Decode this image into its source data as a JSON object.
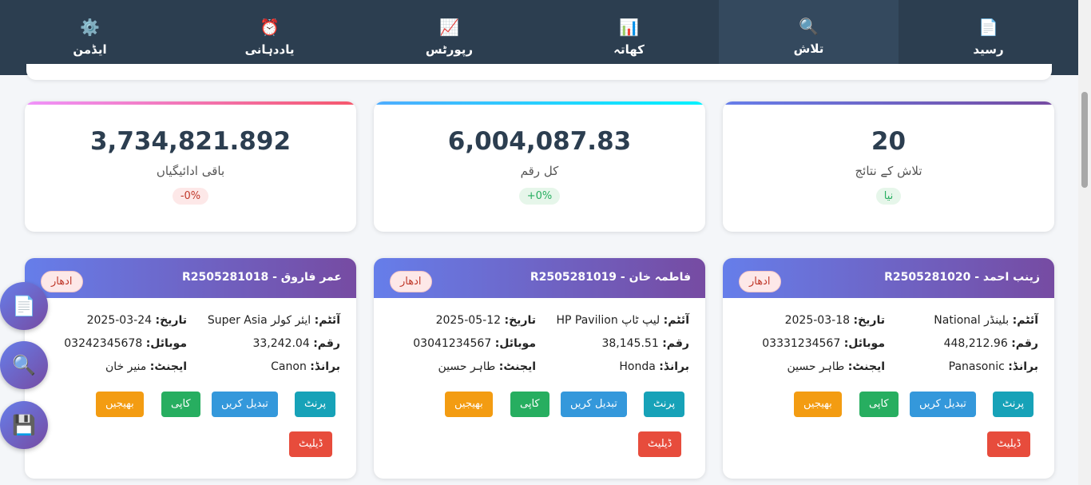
{
  "nav": {
    "items": [
      {
        "label": "رسید",
        "icon": "📄"
      },
      {
        "label": "تلاش",
        "icon": "🔍"
      },
      {
        "label": "کھاتہ",
        "icon": "📊"
      },
      {
        "label": "رپورٹس",
        "icon": "📈"
      },
      {
        "label": "یاددہانی",
        "icon": "⏰"
      },
      {
        "label": "ایڈمن",
        "icon": "⚙️"
      }
    ],
    "active": "تلاش"
  },
  "stats": [
    {
      "value": "20",
      "label": "تلاش کے نتائج",
      "badge": "نیا",
      "color": "#764ba2"
    },
    {
      "value": "6,004,087.83",
      "label": "کل رقم",
      "badge": "+0%",
      "color": "#00d2ff"
    },
    {
      "value": "3,734,821.892",
      "label": "باقی ادائیگیاں",
      "badge": "-0%",
      "color": "#f5576c"
    }
  ],
  "records": [
    {
      "title": "زینب احمد - R2505281020",
      "status": "ادھار",
      "item_label": "آئٹم:",
      "item": "بلینڈر National",
      "date_label": "تاریخ:",
      "date": "18-03-2025",
      "amount_label": "رقم:",
      "amount": "448,212.96",
      "mobile_label": "موبائل:",
      "mobile": "03331234567",
      "brand_label": "برانڈ:",
      "brand": "Panasonic",
      "agent_label": "ایجنٹ:",
      "agent": "طاہر حسین"
    },
    {
      "title": "فاطمہ خان - R2505281019",
      "status": "ادھار",
      "item_label": "آئٹم:",
      "item": "لیپ ٹاپ HP Pavilion",
      "date_label": "تاریخ:",
      "date": "12-05-2025",
      "amount_label": "رقم:",
      "amount": "38,145.51",
      "mobile_label": "موبائل:",
      "mobile": "03041234567",
      "brand_label": "برانڈ:",
      "brand": "Honda",
      "agent_label": "ایجنٹ:",
      "agent": "طاہر حسین"
    },
    {
      "title": "عمر فاروق - R2505281018",
      "status": "ادھار",
      "item_label": "آئٹم:",
      "item": "ایئر کولر Super Asia",
      "date_label": "تاریخ:",
      "date": "24-03-2025",
      "amount_label": "رقم:",
      "amount": "33,242.04",
      "mobile_label": "موبائل:",
      "mobile": "03242345678",
      "brand_label": "برانڈ:",
      "brand": "Canon",
      "agent_label": "ایجنٹ:",
      "agent": "منیر خان"
    }
  ],
  "buttons": {
    "print": "پرنٹ",
    "edit": "تبدیل کریں",
    "copy": "کاپی",
    "send": "بھیجیں",
    "delete": "ڈیلیٹ"
  },
  "fabs": [
    {
      "icon": "📄",
      "name": "receipt-icon"
    },
    {
      "icon": "🔍",
      "name": "search-icon"
    },
    {
      "icon": "💾",
      "name": "save-icon"
    }
  ]
}
